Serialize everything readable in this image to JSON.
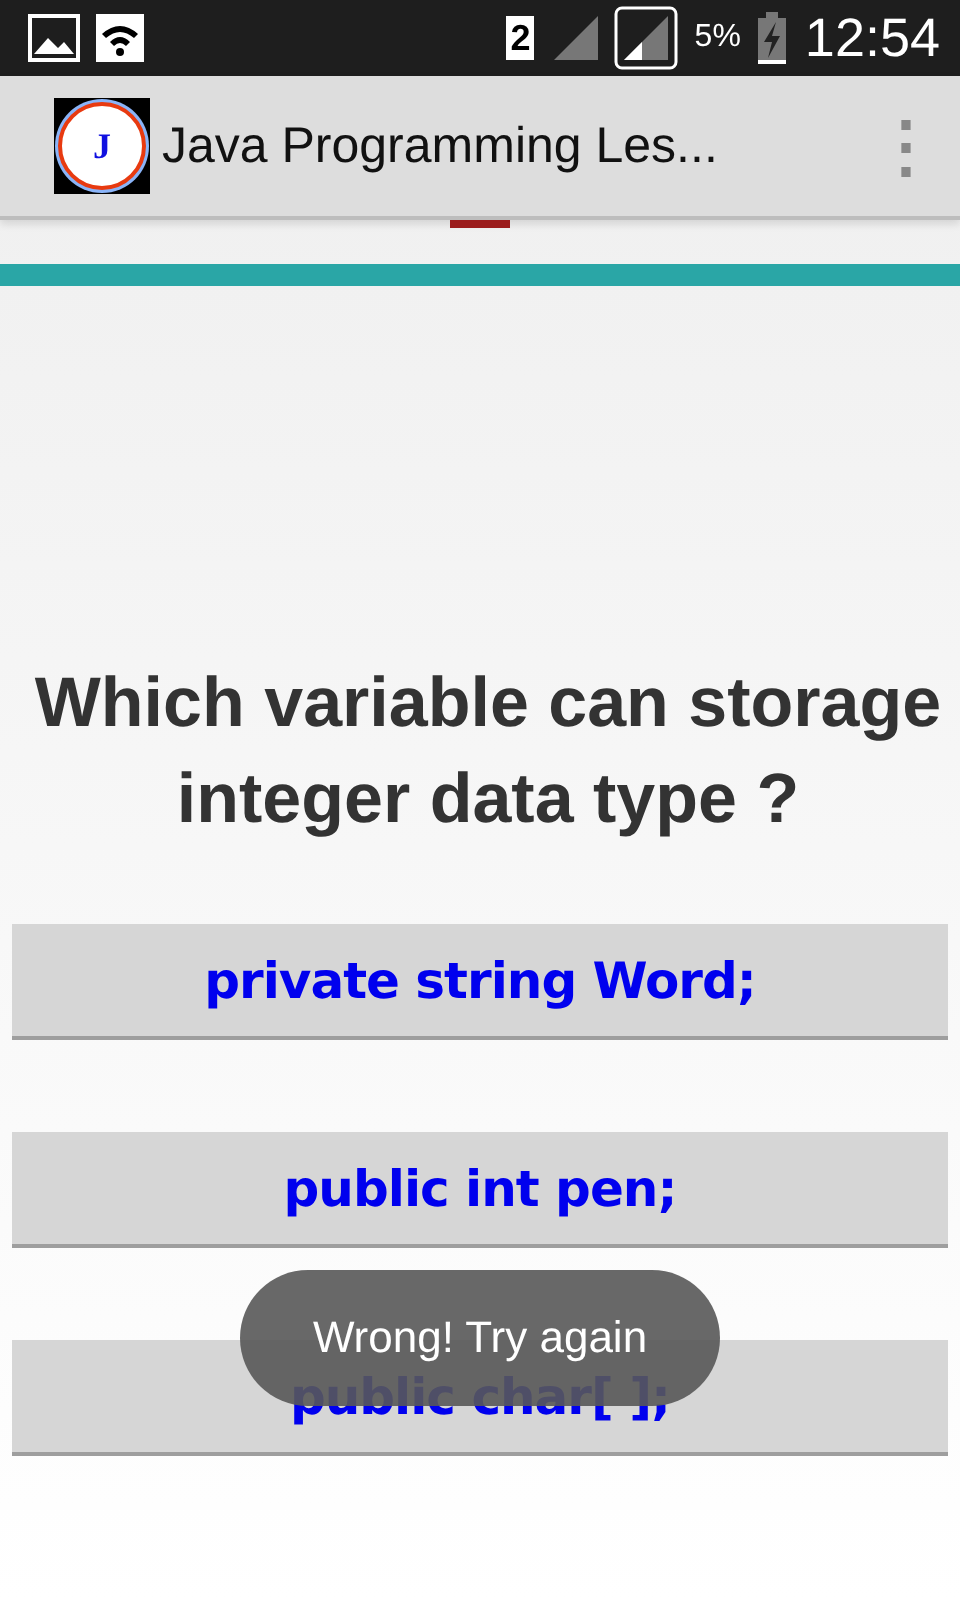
{
  "status_bar": {
    "sim_slot": "2",
    "battery": "5%",
    "time": "12:54"
  },
  "app_bar": {
    "logo_letter": "J",
    "title": "Java Programming Les...",
    "menu": "⋮"
  },
  "question": "Which variable can storage integer data type ?",
  "answers": [
    {
      "label": "private string Word;"
    },
    {
      "label": "public int pen;"
    },
    {
      "label": "public char[ ];"
    }
  ],
  "toast": "Wrong! Try again"
}
